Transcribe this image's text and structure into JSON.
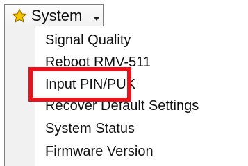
{
  "menu": {
    "title": "System",
    "icon": "star-icon",
    "dropdown_icon": "chevron-down-icon",
    "items": [
      {
        "label": "Signal Quality"
      },
      {
        "label": "Reboot RMV-511"
      },
      {
        "label": "Input PIN/PUK"
      },
      {
        "label": "Recover Default Settings"
      },
      {
        "label": "System Status"
      },
      {
        "label": "Firmware Version"
      }
    ]
  },
  "highlight": {
    "target": "Input PIN/PUK",
    "color": "#e8131b"
  },
  "colors": {
    "star_fill": "#f5c400",
    "star_stroke": "#9a7300",
    "border": "#7f7f7f",
    "gutter": "#f1f1f1"
  }
}
